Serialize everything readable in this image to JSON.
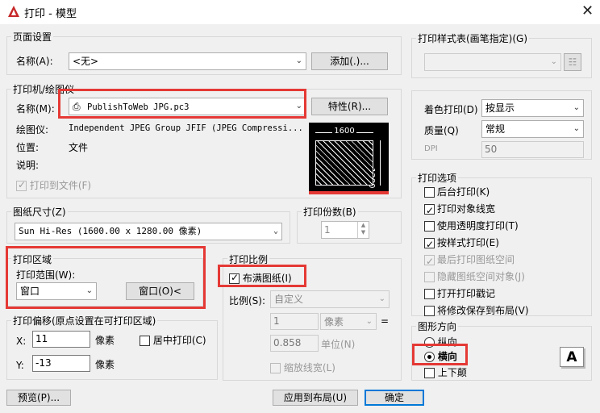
{
  "window": {
    "title": "打印 - 模型",
    "close_glyph": "✕"
  },
  "page_setup": {
    "title": "页面设置",
    "name_label": "名称(A):",
    "name_value": "<无>",
    "add_button": "添加(.)..."
  },
  "printer": {
    "title": "打印机/绘图仪",
    "name_label": "名称(M):",
    "name_value": "PublishToWeb JPG.pc3",
    "properties_button": "特性(R)...",
    "plotter_label": "绘图仪:",
    "plotter_value": "Independent JPEG Group JFIF (JPEG Compressi...",
    "where_label": "位置:",
    "where_value": "文件",
    "description_label": "说明:",
    "print_to_file_label": "打印到文件(F)",
    "preview_width": "1600",
    "preview_height": "1280"
  },
  "paper_size": {
    "title": "图纸尺寸(Z)",
    "value": "Sun Hi-Res (1600.00 x 1280.00 像素)"
  },
  "copies": {
    "title": "打印份数(B)",
    "value": "1"
  },
  "plot_area": {
    "title": "打印区域",
    "what_label": "打印范围(W):",
    "what_value": "窗口",
    "window_button": "窗口(O)<"
  },
  "plot_scale": {
    "title": "打印比例",
    "fit_label": "布满图纸(I)",
    "scale_label": "比例(S):",
    "scale_value": "自定义",
    "value1": "1",
    "unit1": "像素",
    "equals": "=",
    "value2": "0.858",
    "unit2": "单位(N)",
    "lineweights_label": "缩放线宽(L)"
  },
  "plot_offset": {
    "title": "打印偏移(原点设置在可打印区域)",
    "x_label": "X:",
    "x_value": "11",
    "x_unit": "像素",
    "center_label": "居中打印(C)",
    "y_label": "Y:",
    "y_value": "-13",
    "y_unit": "像素"
  },
  "plot_style_table": {
    "title": "打印样式表(画笔指定)(G)",
    "value": ""
  },
  "shaded": {
    "shade_label": "着色打印(D)",
    "shade_value": "按显示",
    "quality_label": "质量(Q)",
    "quality_value": "常规",
    "dpi_label": "DPI",
    "dpi_value": "50"
  },
  "plot_options": {
    "title": "打印选项",
    "items": [
      {
        "label": "后台打印(K)",
        "checked": false,
        "disabled": false
      },
      {
        "label": "打印对象线宽",
        "checked": true,
        "disabled": false
      },
      {
        "label": "使用透明度打印(T)",
        "checked": false,
        "disabled": false
      },
      {
        "label": "按样式打印(E)",
        "checked": true,
        "disabled": false
      },
      {
        "label": "最后打印图纸空间",
        "checked": true,
        "disabled": true
      },
      {
        "label": "隐藏图纸空间对象(J)",
        "checked": false,
        "disabled": true
      },
      {
        "label": "打开打印戳记",
        "checked": false,
        "disabled": false
      },
      {
        "label": "将修改保存到布局(V)",
        "checked": false,
        "disabled": false
      }
    ]
  },
  "orientation": {
    "title": "图形方向",
    "portrait_label": "纵向",
    "landscape_label": "横向",
    "upside_down_label": "上下颠",
    "selected": "横向",
    "icon_letter": "A"
  },
  "footer": {
    "preview_button": "预览(P)...",
    "apply_button": "应用到布局(U)",
    "ok_button": "确定"
  }
}
